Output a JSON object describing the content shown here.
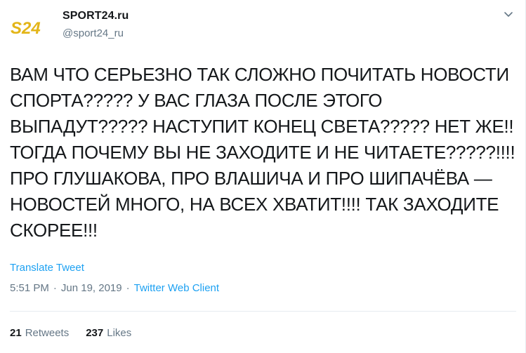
{
  "author": {
    "display_name": "SPORT24.ru",
    "handle": "@sport24_ru",
    "logo_text": "S24",
    "logo_color": "#e3b518"
  },
  "menu_icon": "chevron-down-icon",
  "tweet": {
    "text": "ВАМ ЧТО СЕРЬЕЗНО ТАК СЛОЖНО ПОЧИТАТЬ НОВОСТИ СПОРТА????? У ВАС ГЛАЗА ПОСЛЕ ЭТОГО ВЫПАДУТ????? НАСТУПИТ КОНЕЦ СВЕТА????? НЕТ ЖЕ!! ТОГДА ПОЧЕМУ ВЫ НЕ ЗАХОДИТЕ И НЕ ЧИТАЕТЕ?????!!!! ПРО ГЛУШАКОВА, ПРО ВЛАШИЧА И ПРО ШИПАЧЁВА — НОВОСТЕЙ МНОГО, НА ВСЕХ ХВАТИТ!!!! ТАК ЗАХОДИТЕ СКОРЕЕ!!!",
    "translate_label": "Translate Tweet",
    "time": "5:51 PM",
    "separator": "·",
    "date": "Jun 19, 2019",
    "client": "Twitter Web Client"
  },
  "stats": {
    "retweets_count": "21",
    "retweets_label": "Retweets",
    "likes_count": "237",
    "likes_label": "Likes"
  },
  "colors": {
    "link": "#1da1f2",
    "secondary_text": "#657786",
    "primary_text": "#14171a",
    "divider": "#e6ecf0"
  }
}
